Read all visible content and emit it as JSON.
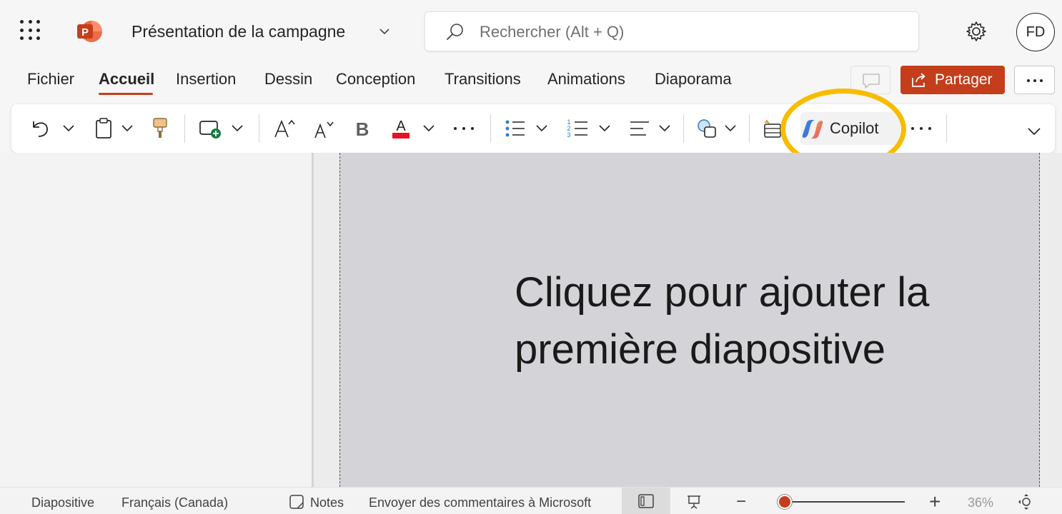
{
  "app": {
    "document_title": "Présentation de la campagne",
    "brand_color": "#c43e1c"
  },
  "header": {
    "search_placeholder": "Rechercher (Alt + Q)",
    "avatar_initials": "FD",
    "icons": [
      "app-launcher-icon",
      "powerpoint-logo",
      "chevron-down-icon",
      "search-icon",
      "gear-icon"
    ]
  },
  "tabs": [
    {
      "label": "Fichier"
    },
    {
      "label": "Accueil",
      "active": true
    },
    {
      "label": "Insertion"
    },
    {
      "label": "Dessin"
    },
    {
      "label": "Conception"
    },
    {
      "label": "Transitions"
    },
    {
      "label": "Animations"
    },
    {
      "label": "Diaporama"
    }
  ],
  "actions": {
    "share_label": "Partager",
    "share_color": "#c43e1c"
  },
  "ribbon": {
    "copilot_label": "Copilot",
    "highlight_color": "#f7bc00",
    "tools": [
      "undo-icon",
      "clipboard-icon",
      "format-painter-icon",
      "new-slide-icon",
      "increase-font-size-icon",
      "decrease-font-size-icon",
      "bold-icon",
      "font-color-icon",
      "more-font-options-icon",
      "bullets-icon",
      "numbering-icon",
      "align-icon",
      "shapes-icon",
      "designer-icon",
      "copilot-icon",
      "more-options-icon",
      "expand-ribbon-icon"
    ],
    "font_color_swatch": "#e81123"
  },
  "slide": {
    "placeholder_line1": "Cliquez pour ajouter la",
    "placeholder_line2": "première diapositive"
  },
  "status": {
    "slide_label": "Diapositive",
    "language": "Français (Canada)",
    "notes_label": "Notes",
    "feedback": "Envoyer des commentaires à Microsoft",
    "zoom_out": "−",
    "zoom_in": "+",
    "zoom_percent": "36%",
    "zoom_fraction": 0.0
  }
}
